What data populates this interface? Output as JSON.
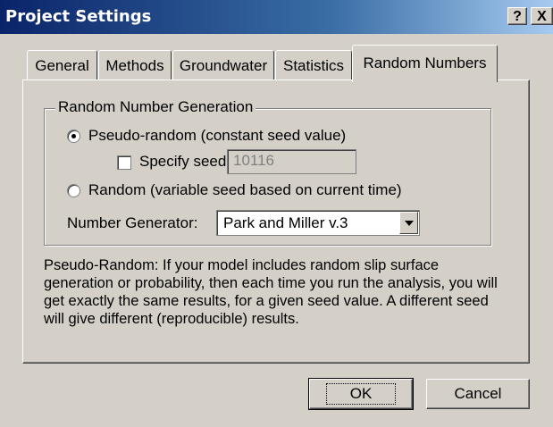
{
  "window": {
    "title": "Project Settings",
    "help_label": "?",
    "close_label": "X"
  },
  "tabs": [
    {
      "label": "General",
      "active": false
    },
    {
      "label": "Methods",
      "active": false
    },
    {
      "label": "Groundwater",
      "active": false
    },
    {
      "label": "Statistics",
      "active": false
    },
    {
      "label": "Random Numbers",
      "active": true
    }
  ],
  "group": {
    "label": "Random Number Generation",
    "pseudo_random_label": "Pseudo-random (constant seed value)",
    "pseudo_random_selected": true,
    "specify_seed_label": "Specify seed",
    "specify_seed_checked": false,
    "seed_value": "10116",
    "random_label": "Random (variable seed based on current time)",
    "random_selected": false,
    "generator_label": "Number Generator:",
    "generator_value": "Park and Miller v.3"
  },
  "description": "Pseudo-Random: If your model includes random slip surface generation or probability, then each time you run the analysis, you will get exactly the same results, for a given seed value. A different seed will give different (reproducible) results.",
  "buttons": {
    "ok_label": "OK",
    "cancel_label": "Cancel"
  }
}
